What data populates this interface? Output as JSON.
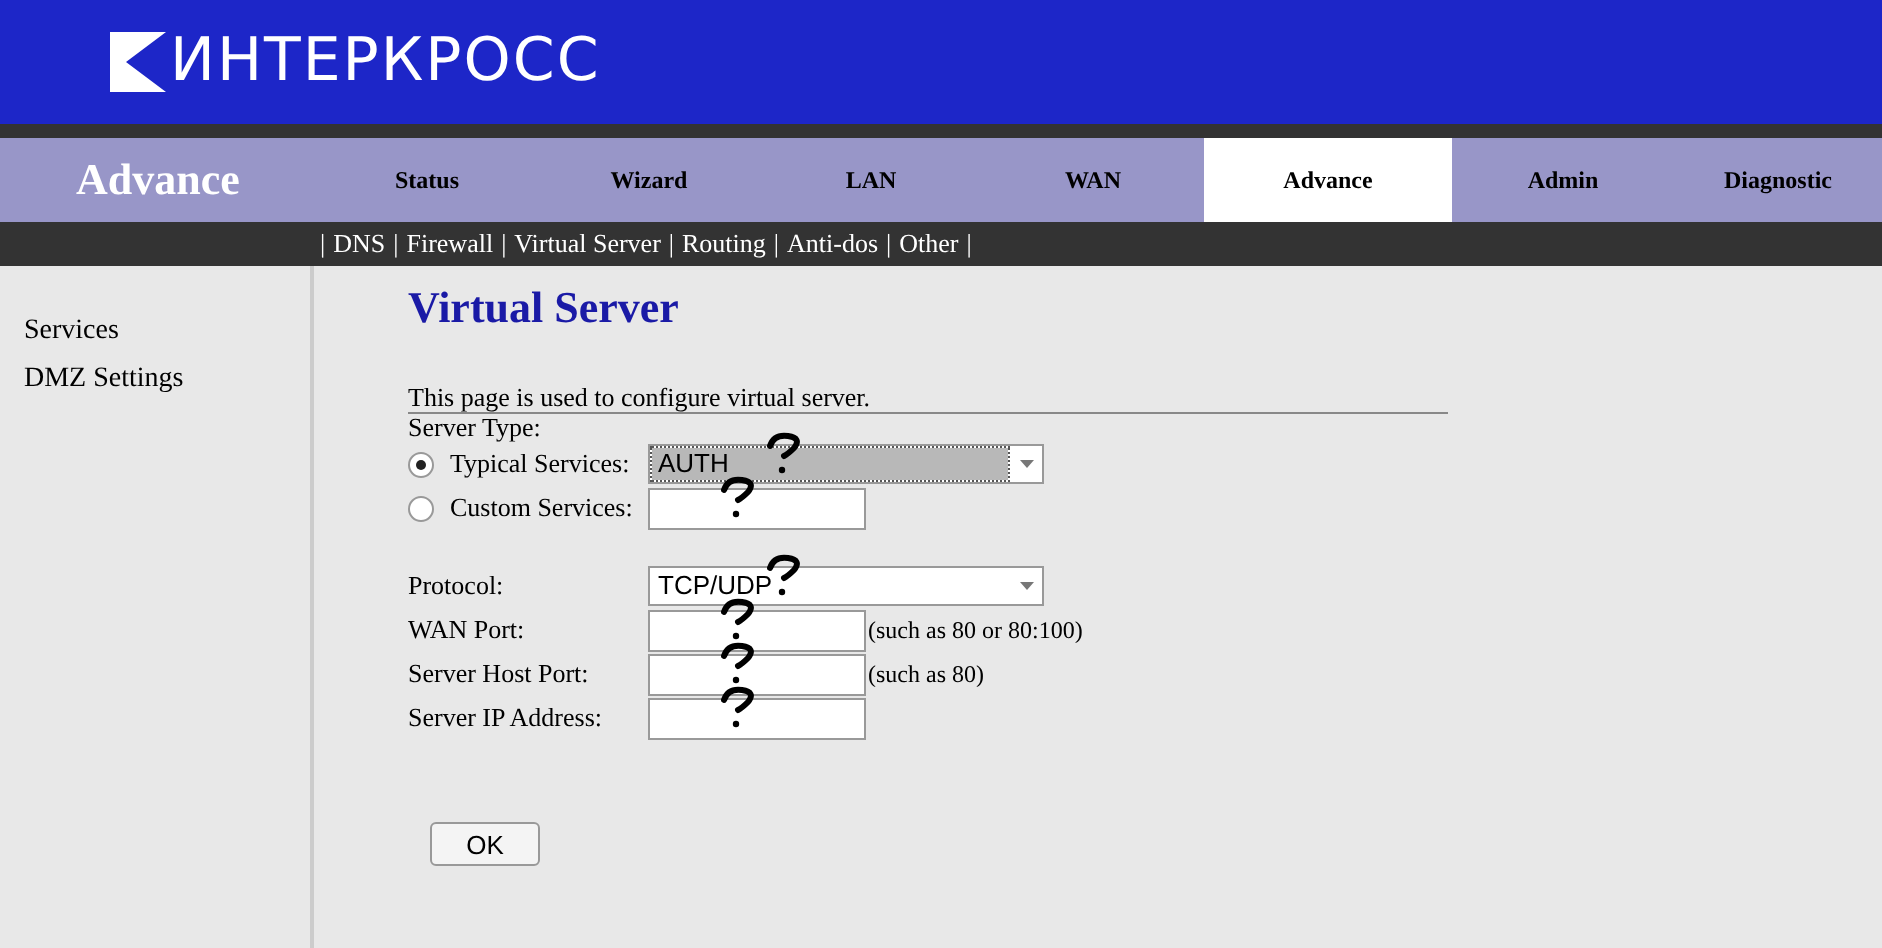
{
  "header": {
    "logo_text": "ИНТЕРКРОСС"
  },
  "nav": {
    "section_title": "Advance",
    "tabs": [
      {
        "label": "Status",
        "selected": false
      },
      {
        "label": "Wizard",
        "selected": false
      },
      {
        "label": "LAN",
        "selected": false
      },
      {
        "label": "WAN",
        "selected": false
      },
      {
        "label": "Advance",
        "selected": true
      },
      {
        "label": "Admin",
        "selected": false
      },
      {
        "label": "Diagnostic",
        "selected": false
      }
    ]
  },
  "subnav": {
    "links": [
      "DNS",
      "Firewall",
      "Virtual Server",
      "Routing",
      "Anti-dos",
      "Other"
    ],
    "separator": "|"
  },
  "sidebar": {
    "items": [
      "Services",
      "DMZ Settings"
    ]
  },
  "page": {
    "title": "Virtual Server",
    "description": "This page is used to configure virtual server.",
    "server_type_label": "Server Type:",
    "options": [
      {
        "kind": "select",
        "label": "Typical Services:",
        "selected": true,
        "value": "AUTH",
        "focused": true,
        "annotated": true
      },
      {
        "kind": "text",
        "label": "Custom Services:",
        "selected": false,
        "annotated": true
      }
    ],
    "fields": [
      {
        "kind": "select",
        "label": "Protocol:",
        "value": "TCP/UDP",
        "annotated": true
      },
      {
        "kind": "text",
        "label": "WAN Port:",
        "hint": "(such as 80 or 80:100)",
        "annotated": true
      },
      {
        "kind": "text",
        "label": "Server Host Port:",
        "hint": "(such as 80)",
        "annotated": true
      },
      {
        "kind": "text",
        "label": "Server IP Address:",
        "annotated": true
      }
    ],
    "ok_button": "OK"
  }
}
